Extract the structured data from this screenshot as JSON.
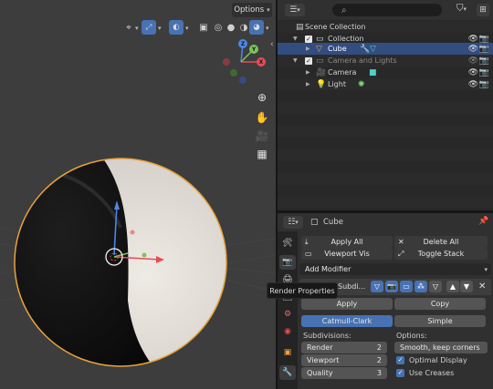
{
  "viewport": {
    "options_label": "Options",
    "icons": [
      "cursor-icon",
      "view-icon",
      "overlay-icon",
      "shading-icon"
    ],
    "gizmo": {
      "x": "X",
      "y": "Y",
      "z": "Z"
    },
    "tooltip": "Render Properties"
  },
  "outliner": {
    "search_icon": "⌕",
    "rows": [
      {
        "label": "Scene Collection"
      },
      {
        "label": "Collection"
      },
      {
        "label": "Cube"
      },
      {
        "label": "Camera and Lights"
      },
      {
        "label": "Camera"
      },
      {
        "label": "Light"
      }
    ]
  },
  "properties": {
    "object_name": "Cube",
    "apply_all": "Apply All",
    "delete_all": "Delete All",
    "viewport_vis": "Viewport Vis",
    "toggle_stack": "Toggle Stack",
    "add_modifier": "Add Modifier",
    "modifier_name": "Subdi...",
    "apply": "Apply",
    "copy": "Copy",
    "catmull_clark": "Catmull-Clark",
    "simple": "Simple",
    "subdivisions_label": "Subdivisions:",
    "options_label": "Options:",
    "render_label": "Render",
    "render_value": "2",
    "viewport_label": "Viewport",
    "viewport_value": "2",
    "quality_label": "Quality",
    "quality_value": "3",
    "uv_smooth": "Smooth, keep corners",
    "optimal_display": "Optimal Display",
    "use_creases": "Use Creases"
  },
  "colors": {
    "accent": "#4772b3",
    "selection": "#334d80",
    "object_outline": "#e8a23c"
  }
}
